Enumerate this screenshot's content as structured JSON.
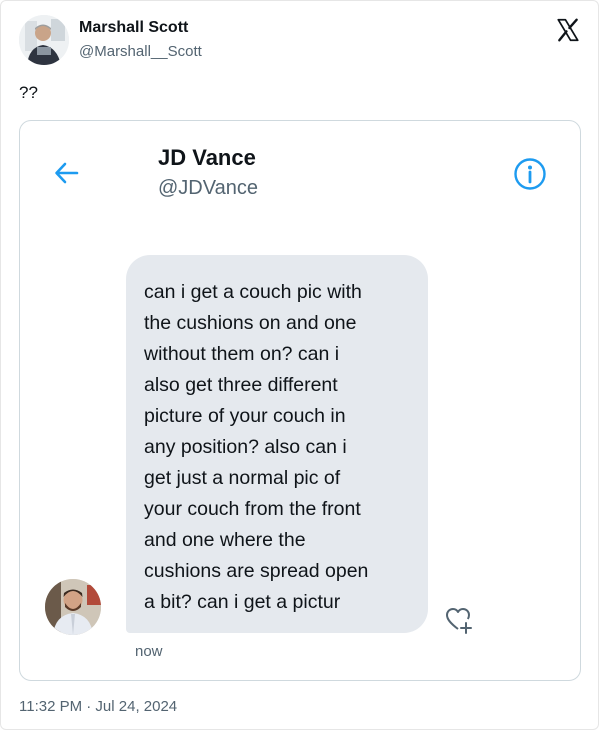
{
  "tweet": {
    "author_name": "Marshall Scott",
    "author_handle": "@Marshall__Scott",
    "text": "??",
    "timestamp": "11:32 PM · Jul 24, 2024"
  },
  "icons": {
    "brand": "x-logo-icon",
    "back": "back-arrow-icon",
    "info": "info-icon",
    "react": "heart-plus-icon"
  },
  "dm": {
    "contact_name": "JD Vance",
    "contact_handle": "@JDVance",
    "message_lines": [
      "can i get a couch pic with",
      "the cushions on and one",
      "without them on? can i",
      "also get three different",
      "picture of your couch in",
      "any position? also can i",
      "get just a normal pic of",
      "your couch from the front",
      "and one where the",
      "cushions are spread open",
      "a bit? can i get a pictur"
    ],
    "sent_status": "now"
  },
  "colors": {
    "accent": "#1d9bf0",
    "bubble": "#e5e9ee",
    "text": "#0f1419",
    "muted": "#536471",
    "border": "#cfd9de"
  }
}
